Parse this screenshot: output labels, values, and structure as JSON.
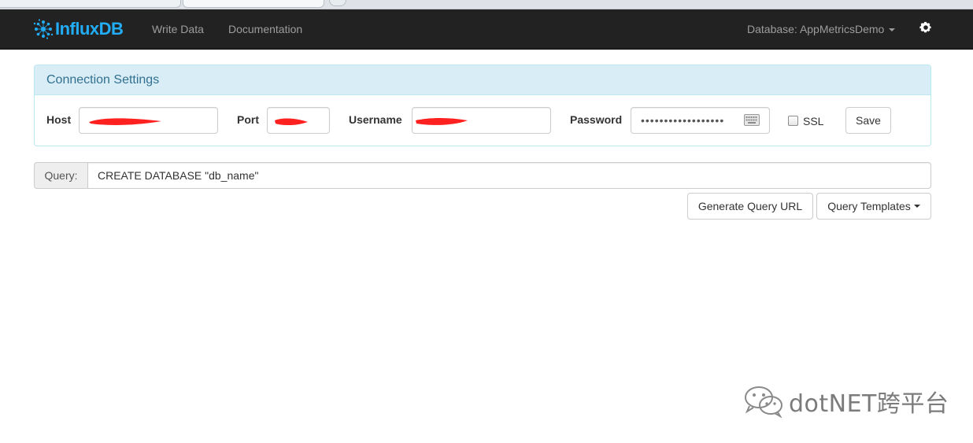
{
  "app": {
    "brand": "InfluxDB",
    "brand_color": "#22adf6"
  },
  "navbar": {
    "write_data": "Write Data",
    "documentation": "Documentation",
    "database_selector": "Database: AppMetricsDemo",
    "settings_icon": "gear-icon"
  },
  "connection": {
    "heading": "Connection Settings",
    "host_label": "Host",
    "host_value": "",
    "port_label": "Port",
    "port_value": "",
    "username_label": "Username",
    "username_value": "",
    "password_label": "Password",
    "password_value": "••••••••••••••••••",
    "ssl_label": "SSL",
    "ssl_checked": false,
    "save_label": "Save"
  },
  "query": {
    "addon_label": "Query:",
    "value": "CREATE DATABASE \"db_name\"",
    "generate_url_label": "Generate Query URL",
    "templates_label": "Query Templates"
  },
  "watermark": {
    "text": "dotNET跨平台",
    "icon": "wechat-icon"
  },
  "colors": {
    "navbar_bg": "#222222",
    "panel_heading_bg": "#d9edf7",
    "panel_heading_text": "#31708f",
    "redaction": "#ff2020"
  }
}
